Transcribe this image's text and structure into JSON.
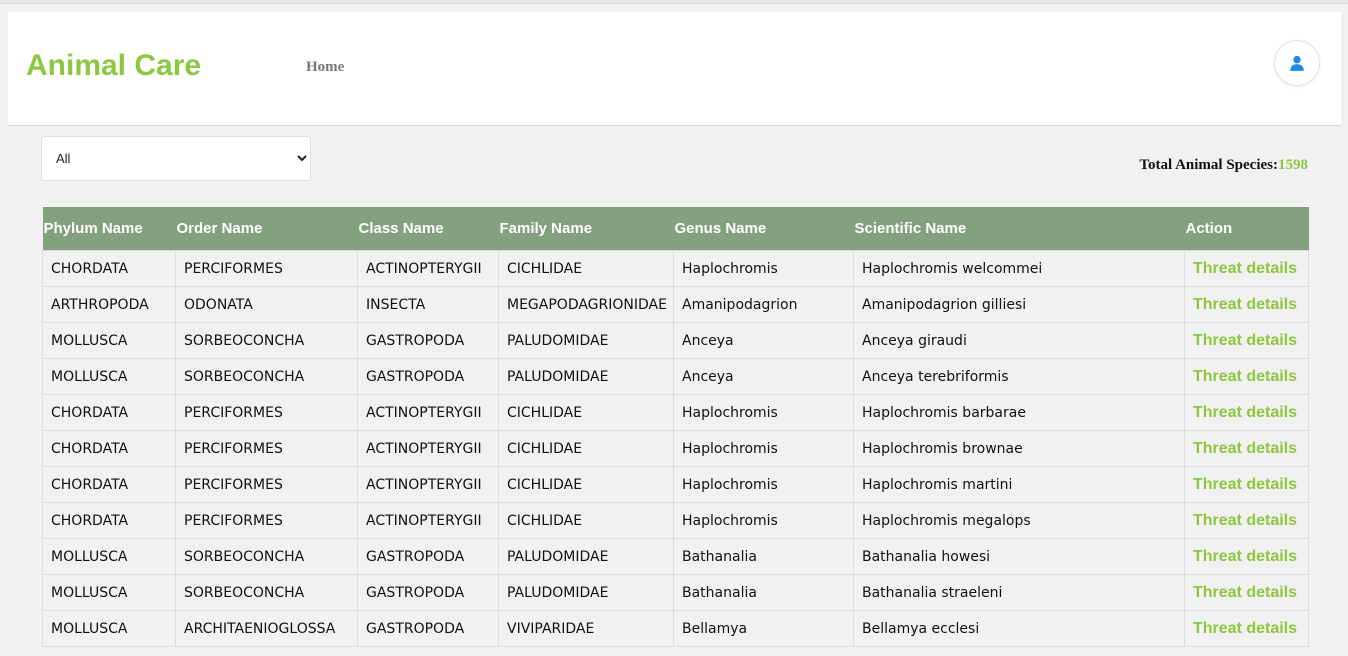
{
  "header": {
    "brand": "Animal Care",
    "nav": {
      "home_label": "Home"
    },
    "user_icon": "user-icon"
  },
  "filter": {
    "selected": "All",
    "options": [
      "All"
    ]
  },
  "summary": {
    "label": "Total Animal Species:",
    "count": "1598"
  },
  "colors": {
    "brand": "#8dc63f",
    "table_header": "#84a17f",
    "background": "#f1f1f1"
  },
  "table": {
    "columns": [
      "Phylum Name",
      "Order Name",
      "Class Name",
      "Family Name",
      "Genus Name",
      "Scientific Name",
      "Action"
    ],
    "action_label": "Threat details",
    "rows": [
      {
        "phylum": "CHORDATA",
        "order": "PERCIFORMES",
        "class": "ACTINOPTERYGII",
        "family": "CICHLIDAE",
        "genus": "Haplochromis",
        "scientific": "Haplochromis welcommei"
      },
      {
        "phylum": "ARTHROPODA",
        "order": "ODONATA",
        "class": "INSECTA",
        "family": "MEGAPODAGRIONIDAE",
        "genus": "Amanipodagrion",
        "scientific": "Amanipodagrion gilliesi"
      },
      {
        "phylum": "MOLLUSCA",
        "order": "SORBEOCONCHA",
        "class": "GASTROPODA",
        "family": "PALUDOMIDAE",
        "genus": "Anceya",
        "scientific": "Anceya giraudi"
      },
      {
        "phylum": "MOLLUSCA",
        "order": "SORBEOCONCHA",
        "class": "GASTROPODA",
        "family": "PALUDOMIDAE",
        "genus": "Anceya",
        "scientific": "Anceya terebriformis"
      },
      {
        "phylum": "CHORDATA",
        "order": "PERCIFORMES",
        "class": "ACTINOPTERYGII",
        "family": "CICHLIDAE",
        "genus": "Haplochromis",
        "scientific": "Haplochromis barbarae"
      },
      {
        "phylum": "CHORDATA",
        "order": "PERCIFORMES",
        "class": "ACTINOPTERYGII",
        "family": "CICHLIDAE",
        "genus": "Haplochromis",
        "scientific": "Haplochromis brownae"
      },
      {
        "phylum": "CHORDATA",
        "order": "PERCIFORMES",
        "class": "ACTINOPTERYGII",
        "family": "CICHLIDAE",
        "genus": "Haplochromis",
        "scientific": "Haplochromis martini"
      },
      {
        "phylum": "CHORDATA",
        "order": "PERCIFORMES",
        "class": "ACTINOPTERYGII",
        "family": "CICHLIDAE",
        "genus": "Haplochromis",
        "scientific": "Haplochromis megalops"
      },
      {
        "phylum": "MOLLUSCA",
        "order": "SORBEOCONCHA",
        "class": "GASTROPODA",
        "family": "PALUDOMIDAE",
        "genus": "Bathanalia",
        "scientific": "Bathanalia howesi"
      },
      {
        "phylum": "MOLLUSCA",
        "order": "SORBEOCONCHA",
        "class": "GASTROPODA",
        "family": "PALUDOMIDAE",
        "genus": "Bathanalia",
        "scientific": "Bathanalia straeleni"
      },
      {
        "phylum": "MOLLUSCA",
        "order": "ARCHITAENIOGLOSSA",
        "class": "GASTROPODA",
        "family": "VIVIPARIDAE",
        "genus": "Bellamya",
        "scientific": "Bellamya ecclesi"
      }
    ]
  }
}
